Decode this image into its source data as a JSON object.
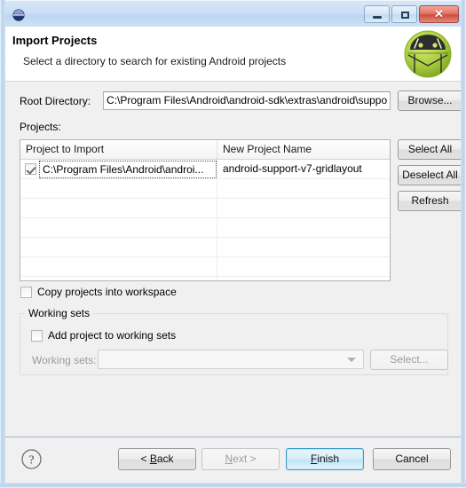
{
  "window": {
    "icon": "eclipse-globe-icon",
    "controls": {
      "minimize": "minimize-icon",
      "maximize": "maximize-icon",
      "close_label": "✕"
    }
  },
  "header": {
    "title": "Import Projects",
    "subtitle": "Select a directory to search for existing Android projects",
    "logo": "android-robot-icon"
  },
  "form": {
    "root_directory_label": "Root Directory:",
    "root_directory_value": "C:\\Program Files\\Android\\android-sdk\\extras\\android\\suppo",
    "root_directory_placeholder": "",
    "browse_label": "Browse...",
    "projects_label": "Projects:"
  },
  "table": {
    "columns": [
      "Project to Import",
      "New Project Name"
    ],
    "rows": [
      {
        "checked": true,
        "project_to_import": "C:\\Program Files\\Android\\androi...",
        "new_project_name": "android-support-v7-gridlayout"
      }
    ],
    "empty_rows": 6
  },
  "side_buttons": [
    {
      "label": "Select All",
      "name": "select-all-button",
      "disabled": false
    },
    {
      "label": "Deselect All",
      "name": "deselect-all-button",
      "disabled": false
    },
    {
      "label": "Refresh",
      "name": "refresh-button",
      "disabled": false
    }
  ],
  "options": {
    "copy_projects_label": "Copy projects into workspace",
    "copy_projects_checked": false
  },
  "working_sets": {
    "group_title": "Working sets",
    "add_project_label": "Add project to working sets",
    "add_project_checked": false,
    "working_sets_label": "Working sets:",
    "working_sets_value": "",
    "select_label": "Select...",
    "select_disabled": true
  },
  "footer": {
    "help_icon": "help-question-icon",
    "buttons": [
      {
        "name": "back-button",
        "label": "< Back",
        "underline": "B",
        "state": "normal"
      },
      {
        "name": "next-button",
        "label": "Next >",
        "underline": "N",
        "state": "disabled"
      },
      {
        "name": "finish-button",
        "label": "Finish",
        "underline": "F",
        "state": "default"
      },
      {
        "name": "cancel-button",
        "label": "Cancel",
        "underline": "",
        "state": "normal"
      }
    ]
  },
  "colors": {
    "title_bar": "#cadff5",
    "dialog_bg": "#f0f0f0",
    "accent_close": "#d04d3e",
    "default_button_border": "#3c9cc8",
    "android_green": "#a4c639"
  }
}
